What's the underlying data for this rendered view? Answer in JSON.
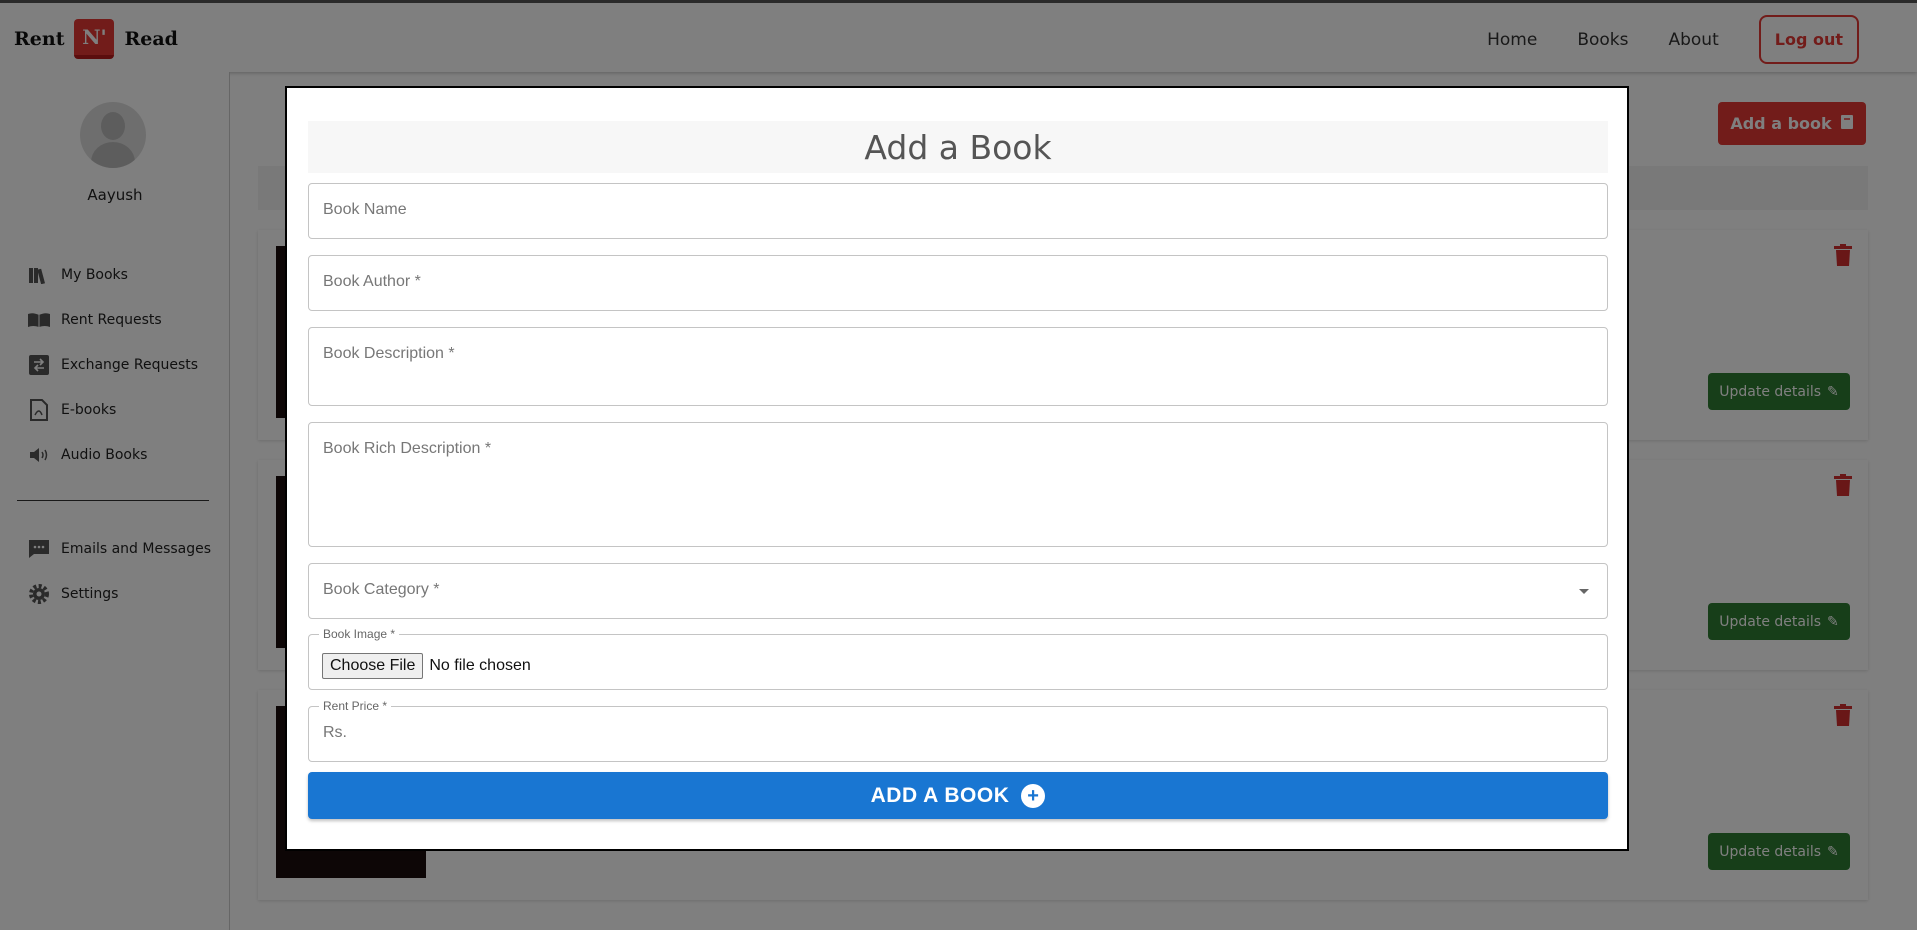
{
  "brand": {
    "left": "Rent",
    "mark": "N'",
    "right": "Read"
  },
  "nav": {
    "items": [
      "Home",
      "Books",
      "About"
    ],
    "logout": "Log out"
  },
  "sidebar": {
    "username": "Aayush",
    "items": [
      {
        "label": "My Books",
        "icon": "books-icon"
      },
      {
        "label": "Rent Requests",
        "icon": "open-book-icon"
      },
      {
        "label": "Exchange Requests",
        "icon": "exchange-icon"
      },
      {
        "label": "E-books",
        "icon": "pdf-icon"
      },
      {
        "label": "Audio Books",
        "icon": "speaker-icon"
      }
    ],
    "secondary": [
      {
        "label": "Emails and Messages",
        "icon": "message-icon"
      },
      {
        "label": "Settings",
        "icon": "gear-icon"
      }
    ]
  },
  "main": {
    "add_book_button": "Add a book",
    "update_button": "Update details"
  },
  "modal": {
    "title": "Add a Book",
    "fields": {
      "name": "Book Name",
      "author": "Book Author *",
      "description": "Book Description *",
      "rich_description": "Book Rich Description *",
      "category": "Book Category *",
      "image_label": "Book Image *",
      "file_button": "Choose File",
      "file_status": "No file chosen",
      "price_label": "Rent Price *",
      "price_placeholder": "Rs."
    },
    "submit": "ADD A BOOK"
  },
  "colors": {
    "brand_red": "#e53935",
    "primary_blue": "#1976d2",
    "success_green": "#2e7d32"
  }
}
